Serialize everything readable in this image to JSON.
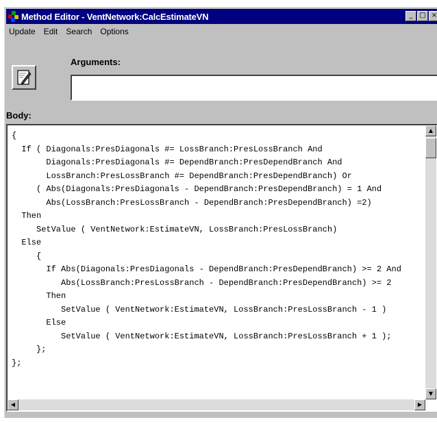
{
  "window": {
    "title": "Method Editor - VentNetwork:CalcEstimateVN",
    "controls": {
      "minimize": "_",
      "maximize": "□",
      "close": "×"
    }
  },
  "menu": [
    "Update",
    "Edit",
    "Search",
    "Options"
  ],
  "toolbar": {
    "edit_icon": "notepad-pencil-icon"
  },
  "arguments": {
    "label": "Arguments:",
    "value": ""
  },
  "body": {
    "label": "Body:",
    "code": "{\n  If ( Diagonals:PresDiagonals #= LossBranch:PresLossBranch And\n       Diagonals:PresDiagonals #= DependBranch:PresDependBranch And\n       LossBranch:PresLossBranch #= DependBranch:PresDependBranch) Or\n     ( Abs(Diagonals:PresDiagonals - DependBranch:PresDependBranch) = 1 And\n       Abs(LossBranch:PresLossBranch - DependBranch:PresDependBranch) =2)\n  Then\n     SetValue ( VentNetwork:EstimateVN, LossBranch:PresLossBranch)\n  Else\n     {\n       If Abs(Diagonals:PresDiagonals - DependBranch:PresDependBranch) >= 2 And\n          Abs(LossBranch:PresLossBranch - DependBranch:PresDependBranch) >= 2\n       Then\n          SetValue ( VentNetwork:EstimateVN, LossBranch:PresLossBranch - 1 )\n       Else\n          SetValue ( VentNetwork:EstimateVN, LossBranch:PresLossBranch + 1 );\n     };\n};"
  },
  "scrollbar": {
    "up": "▲",
    "down": "▼",
    "left": "◀",
    "right": "▶"
  }
}
